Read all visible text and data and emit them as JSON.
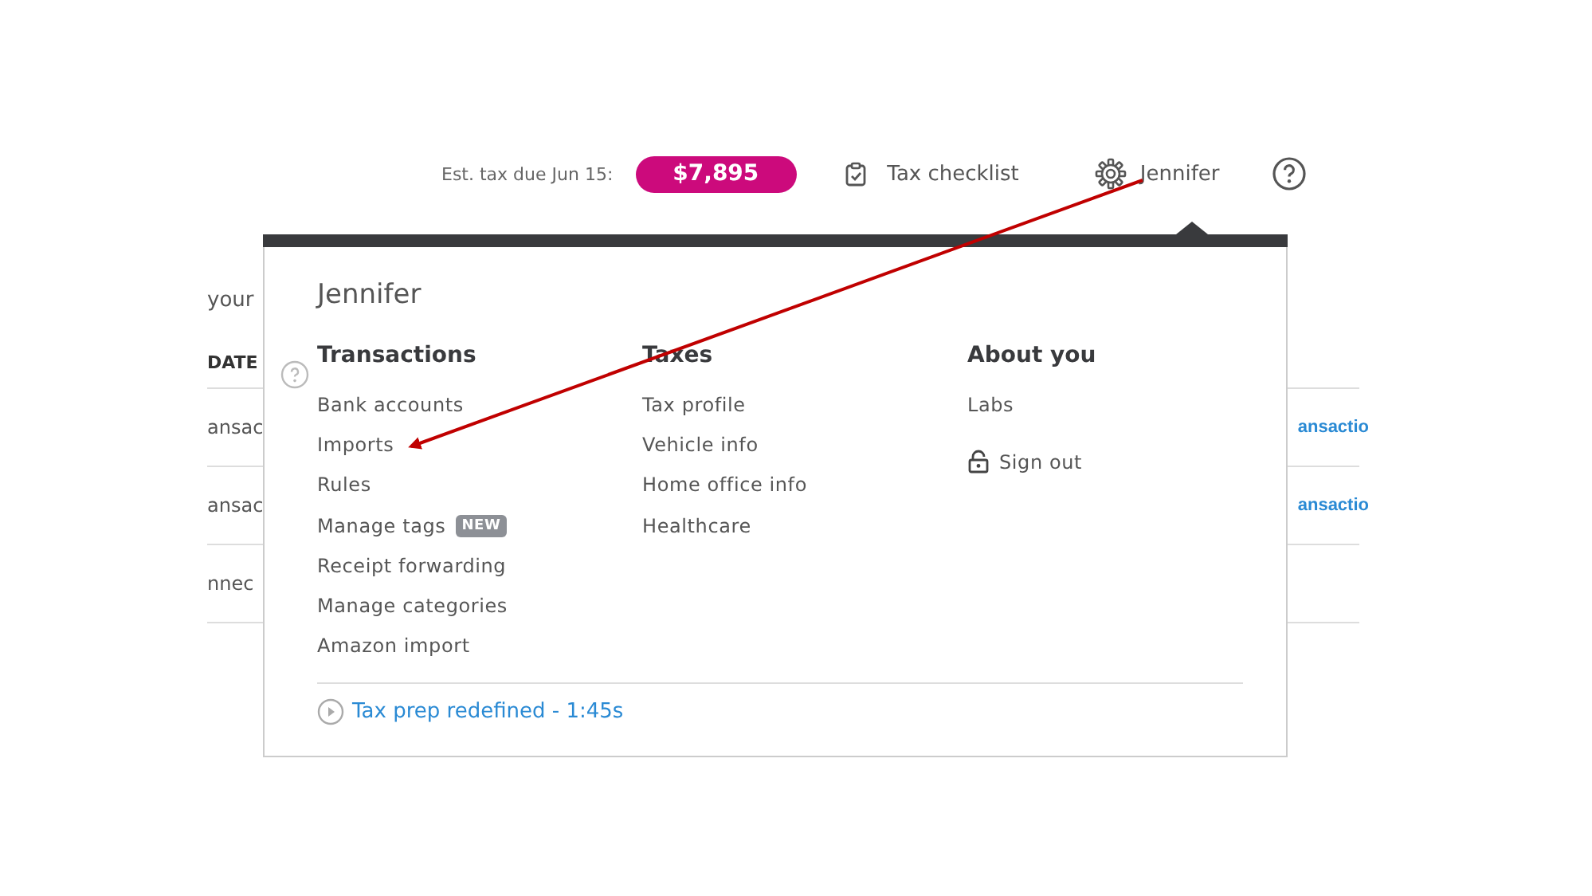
{
  "header": {
    "tax_label": "Est. tax due Jun 15:",
    "tax_amount": "$7,895",
    "checklist": "Tax checklist",
    "user": "Jennifer"
  },
  "background": {
    "intro": "your",
    "column_1": "DATE",
    "rows": [
      {
        "left": "ansac",
        "right": "ansactio"
      },
      {
        "left": "ansac",
        "right": "ansactio"
      },
      {
        "left": "nnec"
      }
    ]
  },
  "menu": {
    "title": "Jennifer",
    "columns": [
      {
        "heading": "Transactions",
        "items": [
          {
            "label": "Bank accounts"
          },
          {
            "label": "Imports"
          },
          {
            "label": "Rules"
          },
          {
            "label": "Manage tags",
            "badge": "NEW"
          },
          {
            "label": "Receipt forwarding"
          },
          {
            "label": "Manage categories"
          },
          {
            "label": "Amazon import"
          }
        ]
      },
      {
        "heading": "Taxes",
        "items": [
          {
            "label": "Tax profile"
          },
          {
            "label": "Vehicle info"
          },
          {
            "label": "Home office info"
          },
          {
            "label": "Healthcare"
          }
        ]
      },
      {
        "heading": "About you",
        "items": [
          {
            "label": "Labs"
          },
          {
            "label": "Sign out",
            "kind": "signout"
          }
        ]
      }
    ],
    "video_link": "Tax prep redefined - 1:45s"
  }
}
